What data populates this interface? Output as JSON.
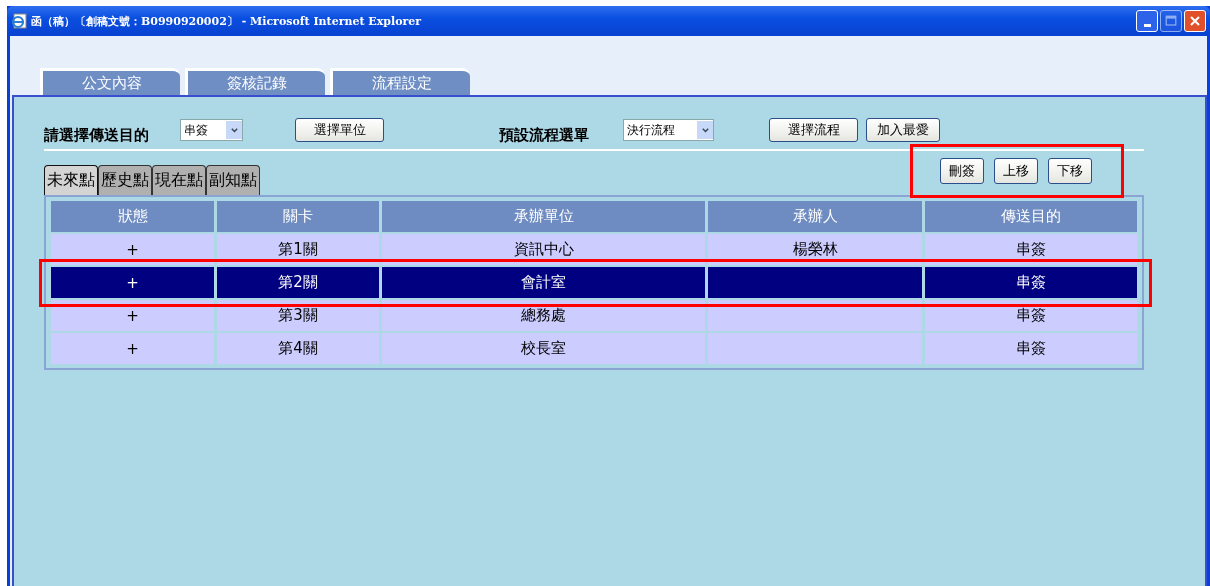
{
  "window": {
    "title": "函（稿）〔創稿文號：B0990920002〕 - Microsoft Internet Explorer",
    "buttons": [
      {
        "kind": "minimize",
        "disabled": false
      },
      {
        "kind": "maximize",
        "disabled": true
      },
      {
        "kind": "close",
        "disabled": false
      }
    ]
  },
  "tabs": [
    {
      "label": "公文內容",
      "selected": false
    },
    {
      "label": "簽核記錄",
      "selected": false
    },
    {
      "label": "流程設定",
      "selected": false
    }
  ],
  "form": {
    "purpose_label": "請選擇傳送目的",
    "purpose_value": "串簽",
    "select_unit_button": "選擇單位",
    "flow_label": "預設流程選單",
    "flow_value": "決行流程",
    "select_flow_button": "選擇流程",
    "favorite_button": "加入最愛"
  },
  "sub_tabs": [
    {
      "label": "未來點",
      "selected": true
    },
    {
      "label": "歷史點",
      "selected": false
    },
    {
      "label": "現在點",
      "selected": false
    },
    {
      "label": "副知點",
      "selected": false
    }
  ],
  "actions": {
    "highlighted": true,
    "buttons": [
      "刪簽",
      "上移",
      "下移"
    ]
  },
  "table": {
    "columns": [
      "狀態",
      "關卡",
      "承辦單位",
      "承辦人",
      "傳送目的"
    ],
    "rows": [
      {
        "cells": [
          "+",
          "第1關",
          "資訊中心",
          "楊榮林",
          "串簽"
        ],
        "selected": false,
        "highlighted": false
      },
      {
        "cells": [
          "+",
          "第2關",
          "會計室",
          "",
          "串簽"
        ],
        "selected": true,
        "highlighted": true
      },
      {
        "cells": [
          "+",
          "第3關",
          "總務處",
          "",
          "串簽"
        ],
        "selected": false,
        "highlighted": false
      },
      {
        "cells": [
          "+",
          "第4關",
          "校長室",
          "",
          "串簽"
        ],
        "selected": false,
        "highlighted": false
      }
    ]
  }
}
